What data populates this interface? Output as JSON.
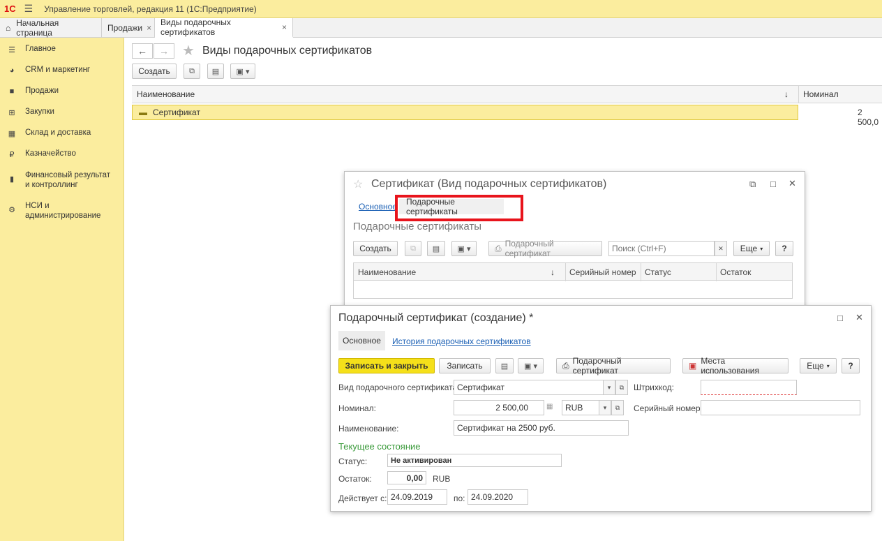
{
  "app": {
    "logo": "1С",
    "menu_icon": "menu-icon",
    "title": "Управление торговлей, редакция 11  (1С:Предприятие)"
  },
  "tabs": [
    {
      "label": "Начальная страница",
      "icon": "home-icon"
    },
    {
      "label": "Продажи",
      "close": "×"
    },
    {
      "label": "Виды подарочных сертификатов",
      "close": "×"
    }
  ],
  "sidebar": {
    "items": [
      {
        "label": "Главное",
        "icon": "list-icon"
      },
      {
        "label": "CRM и маркетинг",
        "icon": "pie-icon"
      },
      {
        "label": "Продажи",
        "icon": "bag-icon"
      },
      {
        "label": "Закупки",
        "icon": "cart-icon"
      },
      {
        "label": "Склад и доставка",
        "icon": "warehouse-icon"
      },
      {
        "label": "Казначейство",
        "icon": "ruble-icon"
      },
      {
        "label": "Финансовый результат и контроллинг",
        "icon": "bar-chart-icon"
      },
      {
        "label": "НСИ и администрирование",
        "icon": "gear-icon"
      }
    ]
  },
  "list_page": {
    "title": "Виды подарочных сертификатов",
    "create_label": "Создать",
    "columns": {
      "name": "Наименование",
      "sort_arrow": "↓",
      "nominal": "Номинал"
    },
    "row": {
      "name": "Сертификат",
      "nominal": "2 500,0"
    }
  },
  "cert_kind_window": {
    "title": "Сертификат (Вид подарочных сертификатов)",
    "tab_main": "Основное",
    "tab_certs": "Подарочные сертификаты",
    "section_title": "Подарочные сертификаты",
    "create_label": "Создать",
    "gift_cert_btn": "Подарочный сертификат",
    "search_placeholder": "Поиск (Ctrl+F)",
    "more_label": "Еще",
    "help_label": "?",
    "columns": {
      "name": "Наименование",
      "sort_arrow": "↓",
      "serial": "Серийный номер",
      "status": "Статус",
      "balance": "Остаток"
    },
    "highlight_color": "#e8141c"
  },
  "cert_form": {
    "title": "Подарочный сертификат (создание) *",
    "tab_main": "Основное",
    "tab_history": "История подарочных сертификатов",
    "save_close_label": "Записать и закрыть",
    "save_label": "Записать",
    "gift_cert_btn": "Подарочный сертификат",
    "usage_btn": "Места использования",
    "more_label": "Еще",
    "help_label": "?",
    "kind_label": "Вид подарочного сертификата:",
    "kind_value": "Сертификат",
    "barcode_label": "Штрихкод:",
    "nominal_label": "Номинал:",
    "nominal_value": "2 500,00",
    "currency_value": "RUB",
    "serial_label": "Серийный номер:",
    "name_label": "Наименование:",
    "name_value": "Сертификат на 2500 руб.",
    "state_title": "Текущее состояние",
    "status_label": "Статус:",
    "status_value": "Не активирован",
    "balance_label": "Остаток:",
    "balance_value": "0,00",
    "balance_currency": "RUB",
    "valid_from_label": "Действует с:",
    "valid_from_value": "24.09.2019",
    "valid_to_label": "по:",
    "valid_to_value": "24.09.2020"
  }
}
